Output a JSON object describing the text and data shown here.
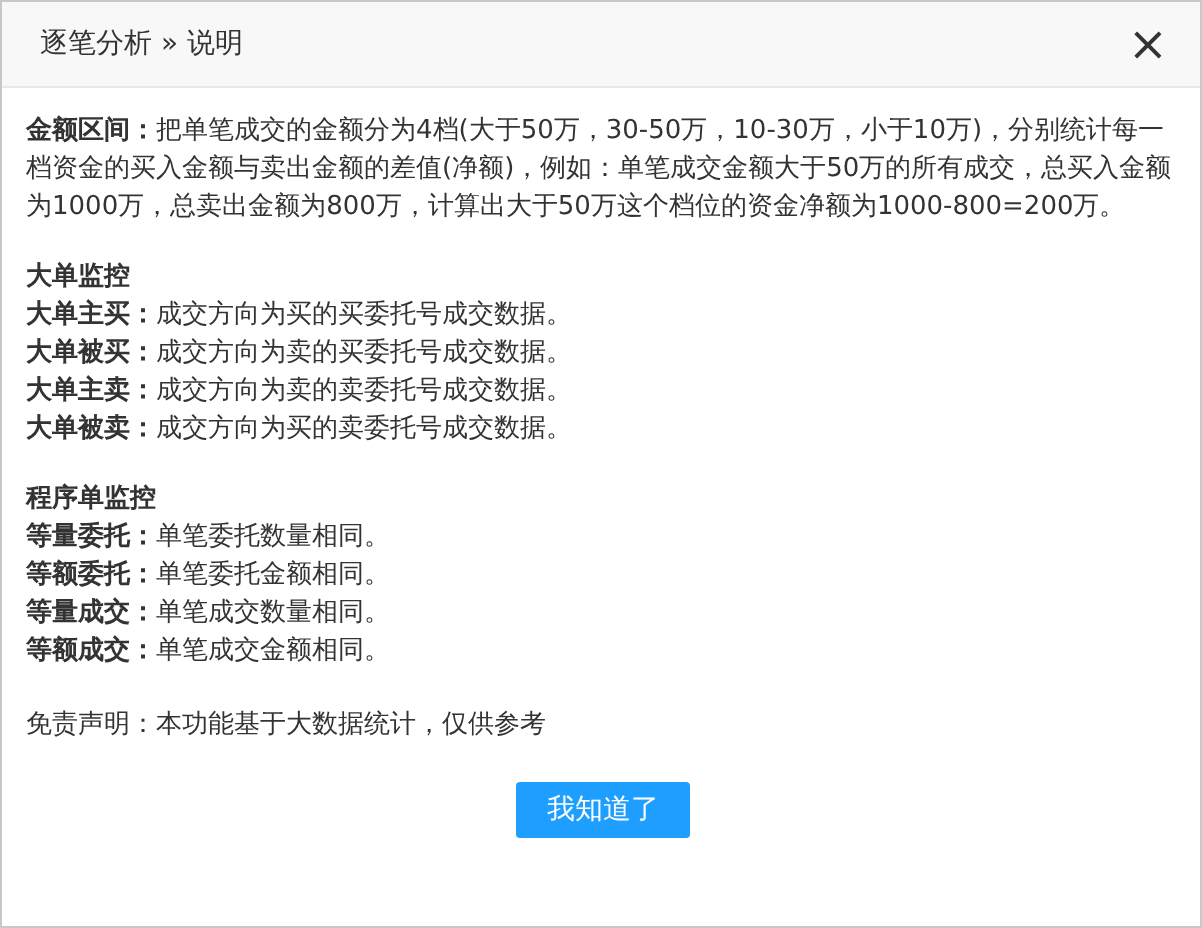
{
  "dialog": {
    "title": "逐笔分析 » 说明",
    "close": "×"
  },
  "intro": "**金额区间：**把单笔成交的金额分为4档(大于50万，30-50万，10-30万，小于10万)，分别统计每一档资金的买入金额与卖出金额的差值(净额)，例如：单笔成交金额大于50万的所有成交，总买入金额为1000万，总卖出金额为800万，计算出大于50万这个档位的资金净额为1000-800=200万。",
  "sections": [
    {
      "heading": "大单监控",
      "items": [
        "**大单主买：**成交方向为买的买委托号成交数据。",
        "**大单被买：**成交方向为卖的买委托号成交数据。",
        "**大单主卖：**成交方向为卖的卖委托号成交数据。",
        "**大单被卖：**成交方向为买的卖委托号成交数据。"
      ]
    },
    {
      "heading": "程序单监控",
      "items": [
        "**等量委托：**单笔委托数量相同。",
        "**等额委托：**单笔委托金额相同。",
        "**等量成交：**单笔成交数量相同。",
        "**等额成交：**单笔成交金额相同。"
      ]
    }
  ],
  "disclaimer": "免责声明：本功能基于大数据统计，仅供参考",
  "button": "我知道了"
}
